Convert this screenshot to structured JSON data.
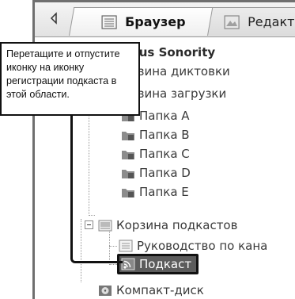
{
  "tabs": [
    {
      "label": "Браузер",
      "active": true,
      "icon": "browser-window-icon"
    },
    {
      "label": "Редакто",
      "active": false,
      "icon": "editor-image-icon"
    }
  ],
  "tree": {
    "root": "pus Sonority",
    "items": [
      {
        "label": "рзина диктовки",
        "icon": "basket-icon"
      },
      {
        "label": "рзина загрузки",
        "icon": "basket-icon"
      },
      {
        "label": "Папка A",
        "icon": "folder-icon",
        "badge": "A"
      },
      {
        "label": "Папка B",
        "icon": "folder-icon",
        "badge": "B"
      },
      {
        "label": "Папка C",
        "icon": "folder-icon",
        "badge": "C"
      },
      {
        "label": "Папка D",
        "icon": "folder-icon",
        "badge": "D"
      },
      {
        "label": "Папка E",
        "icon": "folder-icon",
        "badge": "E"
      },
      {
        "label": "Корзина подкастов",
        "icon": "podcast-basket-icon"
      },
      {
        "label": "Руководство по кана",
        "icon": "guide-icon"
      },
      {
        "label": "Подкаст",
        "icon": "rss-icon",
        "selected": true
      },
      {
        "label": "Компакт-диск",
        "icon": "cd-icon"
      }
    ]
  },
  "callout": {
    "text": "Перетащите и отпустите иконку на иконку регистрации подкаста в этой области."
  },
  "colors": {
    "highlight": "#5c5c5c",
    "border": "#111111",
    "text": "#3a3a3a"
  }
}
